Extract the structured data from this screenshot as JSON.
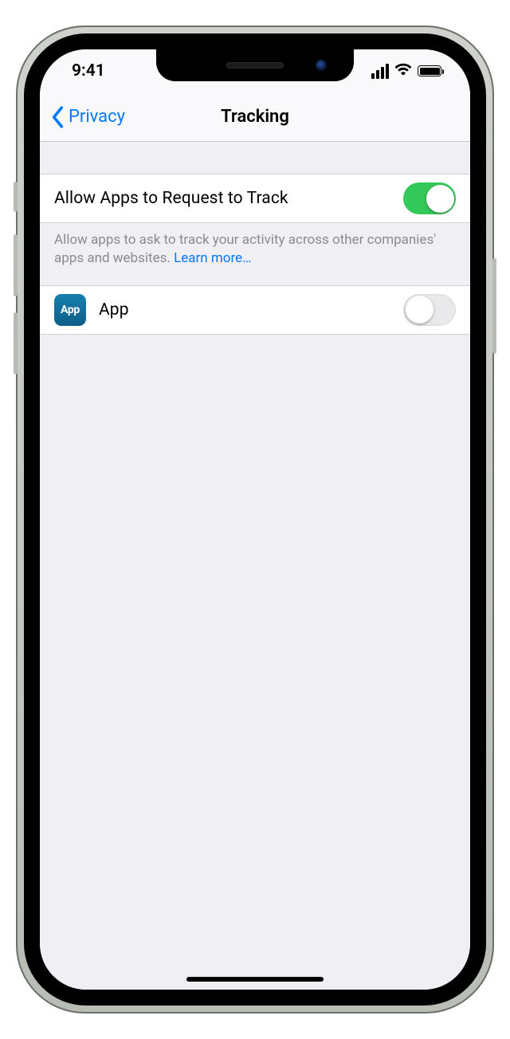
{
  "status": {
    "time": "9:41"
  },
  "nav": {
    "back_label": "Privacy",
    "title": "Tracking"
  },
  "settings": {
    "allow_track_label": "Allow Apps to Request to Track",
    "allow_track_on": true,
    "footer_text": "Allow apps to ask to track your activity across other companies' apps and websites. ",
    "learn_more": "Learn more…"
  },
  "apps": [
    {
      "icon_text": "App",
      "name": "App",
      "tracking_on": false
    }
  ]
}
